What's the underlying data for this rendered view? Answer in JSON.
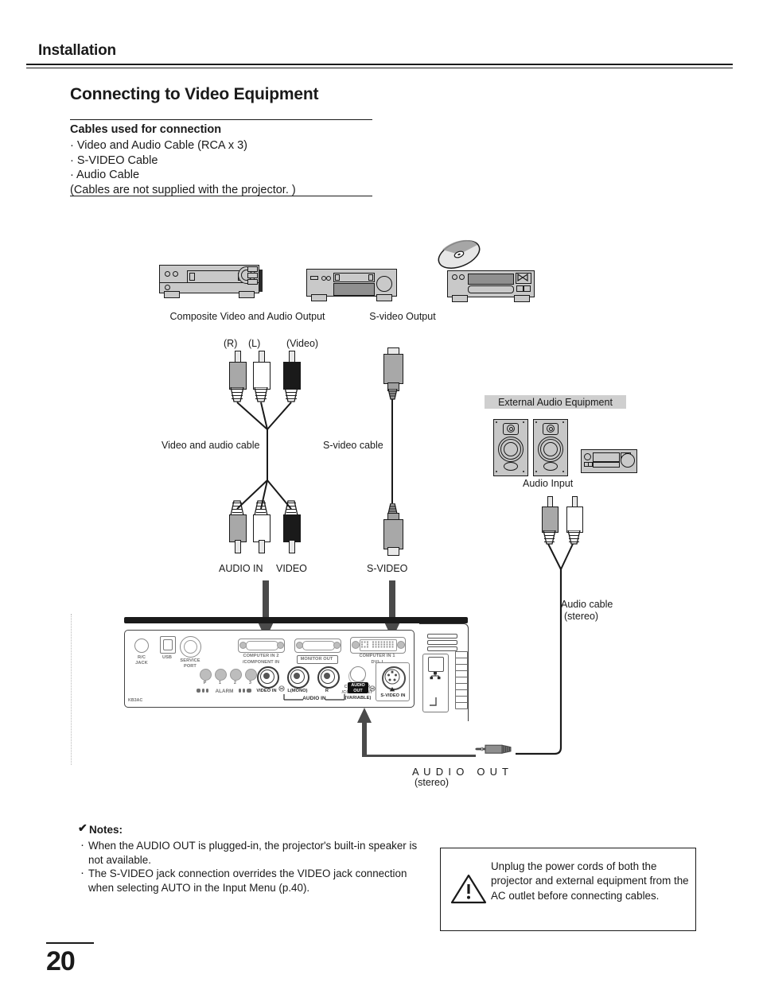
{
  "header": {
    "running_head": "Installation"
  },
  "section": {
    "title": "Connecting to Video Equipment",
    "cables_heading": "Cables used for connection",
    "cables_list": [
      "· Video and Audio Cable (RCA x 3)",
      "· S-VIDEO Cable",
      "· Audio Cable",
      "(Cables are not supplied with the projector. )"
    ]
  },
  "diagram": {
    "source_labels": {
      "composite": "Composite Video and Audio Output",
      "svideo": "S-video Output"
    },
    "plug_top_labels": {
      "r": "(R)",
      "l": "(L)",
      "video": "(Video)"
    },
    "cable_names": {
      "video_audio": "Video and audio cable",
      "svideo": "S-video cable",
      "audio_stereo_l1": "Audio cable",
      "audio_stereo_l2": "(stereo)"
    },
    "plug_bottom_labels": {
      "audio_in": "AUDIO IN",
      "video": "VIDEO",
      "svideo": "S-VIDEO"
    },
    "external_audio": {
      "banner": "External Audio Equipment",
      "audio_input": "Audio Input"
    },
    "audio_out": {
      "line1": "A U D I O   O U T",
      "line2": "(stereo)"
    }
  },
  "panel": {
    "terminals": [
      {
        "id": "rc-jack",
        "label": "R/C\nJACK"
      },
      {
        "id": "usb",
        "label": "USB"
      },
      {
        "id": "service-port",
        "label": "SERVICE\nPORT"
      },
      {
        "id": "computer-in-2",
        "label": "COMPUTER IN 2\n/COMPONENT IN"
      },
      {
        "id": "monitor-out",
        "label": "MONITOR OUT"
      },
      {
        "id": "computer-in-1",
        "label": "COMPUTER IN 1\nDVI- I"
      },
      {
        "id": "video-in",
        "label": "VIDEO IN"
      },
      {
        "id": "audio-in-l",
        "label": "L(MONO)"
      },
      {
        "id": "audio-in-r",
        "label": "R"
      },
      {
        "id": "computer-component",
        "label": "COMPUTER\n/COMPONENT"
      },
      {
        "id": "audio-out",
        "label": "AUDIO\nOUT"
      },
      {
        "id": "audio-out-variable",
        "label": "(VARIABLE)"
      },
      {
        "id": "s-video-in",
        "label": "S-VIDEO IN"
      },
      {
        "id": "audio-in-group",
        "label": "AUDIO IN"
      },
      {
        "id": "alarm",
        "label": "ALARM"
      }
    ],
    "alarm_digits": [
      "P",
      "1",
      "2",
      "3"
    ],
    "code": "KB3AC"
  },
  "notes": {
    "title": "Notes:",
    "check_glyph": "✔",
    "items": [
      "When the AUDIO OUT is plugged-in, the projector's built-in speaker is not available.",
      "The S-VIDEO jack connection overrides the VIDEO jack connection when selecting AUTO in the Input Menu (p.40)."
    ]
  },
  "caution": {
    "text": "Unplug the power cords of both the projector and external equipment from the AC outlet before connecting cables."
  },
  "footer": {
    "page_number": "20"
  },
  "colors": {
    "ink": "#1a1a1a",
    "equipment_gray": "#c9c9c9",
    "dark_gray": "#8f8f8f",
    "banner_gray": "#cfcfcf",
    "plug_gray": "#a8a8a8"
  }
}
